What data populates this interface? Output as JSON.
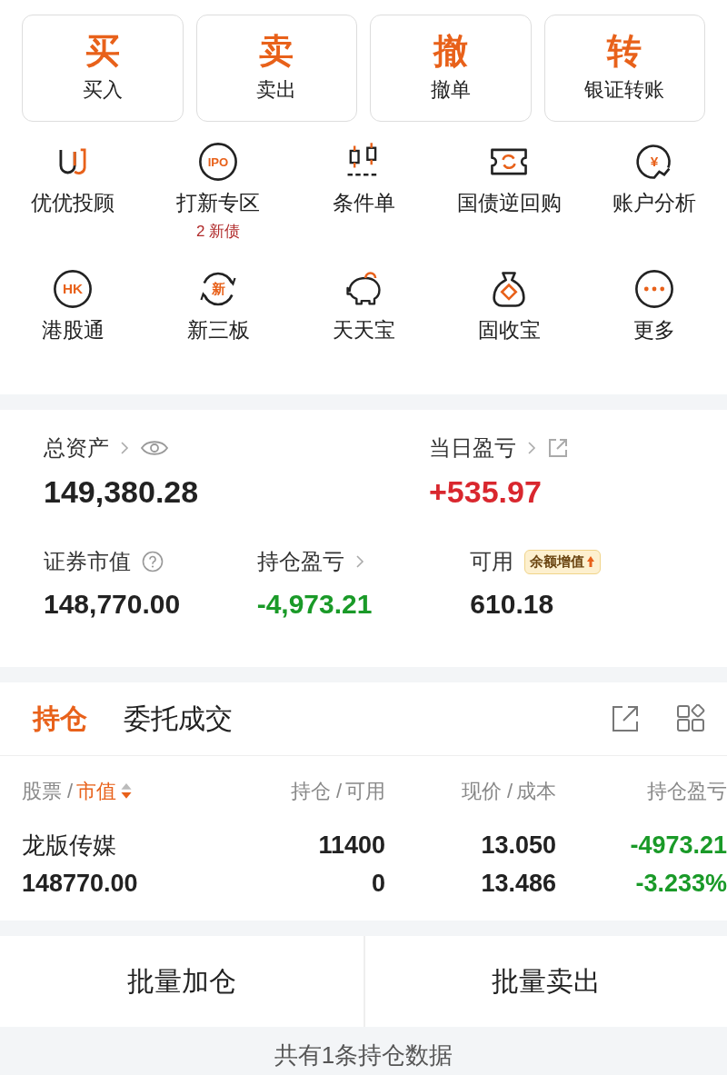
{
  "quick_actions": [
    {
      "char": "买",
      "label": "买入"
    },
    {
      "char": "卖",
      "label": "卖出"
    },
    {
      "char": "撤",
      "label": "撤单"
    },
    {
      "char": "转",
      "label": "银证转账"
    }
  ],
  "features": [
    {
      "label": "优优投顾"
    },
    {
      "label": "打新专区",
      "icon_text": "IPO",
      "badge": "2 新债"
    },
    {
      "label": "条件单"
    },
    {
      "label": "国债逆回购"
    },
    {
      "label": "账户分析",
      "icon_text": "¥"
    },
    {
      "label": "港股通",
      "icon_text": "HK"
    },
    {
      "label": "新三板",
      "icon_text": "新"
    },
    {
      "label": "天天宝"
    },
    {
      "label": "固收宝"
    },
    {
      "label": "更多"
    }
  ],
  "summary": {
    "total_assets": {
      "label": "总资产",
      "value": "149,380.28"
    },
    "daily_pnl": {
      "label": "当日盈亏",
      "value": "+535.97"
    },
    "market_value": {
      "label": "证券市值",
      "value": "148,770.00"
    },
    "position_pnl": {
      "label": "持仓盈亏",
      "value": "-4,973.21"
    },
    "available": {
      "label": "可用",
      "value": "610.18",
      "promo": "余额增值"
    }
  },
  "tabs": [
    {
      "label": "持仓",
      "selected": true
    },
    {
      "label": "委托成交",
      "selected": false
    }
  ],
  "columns": [
    {
      "primary": "股票 /",
      "secondary": "市值",
      "sorted": true
    },
    {
      "primary": "持仓 /",
      "secondary": "可用",
      "sorted": false
    },
    {
      "primary": "现价 /",
      "secondary": "成本",
      "sorted": false
    },
    {
      "primary": "持仓盈亏",
      "sorted": false
    }
  ],
  "holdings": [
    {
      "name": "龙版传媒",
      "market_value": "148770.00",
      "quantity": "11400",
      "available": "0",
      "price": "13.050",
      "cost": "13.486",
      "pnl": "-4973.21",
      "pnl_pct": "-3.233%"
    }
  ],
  "batch_buttons": [
    "批量加仓",
    "批量卖出"
  ],
  "footer": "共有1条持仓数据"
}
